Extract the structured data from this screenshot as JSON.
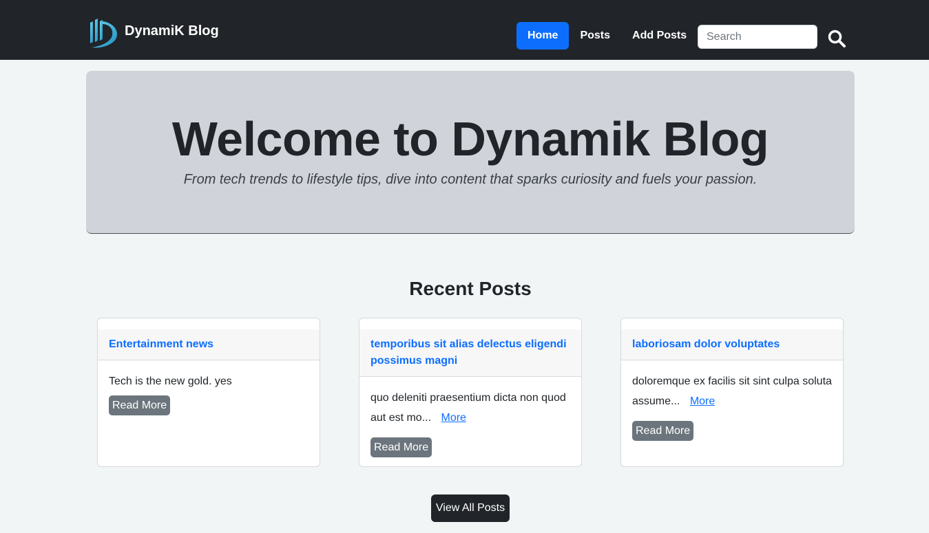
{
  "navbar": {
    "brand": "DynamiK Blog",
    "links": [
      {
        "label": "Home",
        "active": true
      },
      {
        "label": "Posts",
        "active": false
      },
      {
        "label": "Add Posts",
        "active": false
      }
    ],
    "search_placeholder": "Search",
    "search_value": ""
  },
  "hero": {
    "title": "Welcome to Dynamik Blog",
    "subtitle": "From tech trends to lifestyle tips, dive into content that sparks curiosity and fuels your passion."
  },
  "recent": {
    "title": "Recent Posts",
    "posts": [
      {
        "title": "Entertainment news",
        "excerpt": "Tech is the new gold. yes",
        "more": "",
        "button": "Read More"
      },
      {
        "title": "temporibus sit alias delectus eligendi possimus magni",
        "excerpt": "quo deleniti praesentium dicta non quod aut est mo...",
        "more": "More",
        "button": "Read More"
      },
      {
        "title": "laboriosam dolor voluptates",
        "excerpt": "doloremque ex facilis sit sint culpa soluta assume...",
        "more": "More",
        "button": "Read More"
      }
    ],
    "view_all": "View All Posts"
  },
  "colors": {
    "navbar_bg": "#212529",
    "accent": "#0d6efd",
    "hero_bg": "#d0d4da",
    "secondary_button": "#6c757d"
  },
  "icons": {
    "brand": "dynamik-logo-icon",
    "search": "search-icon"
  }
}
